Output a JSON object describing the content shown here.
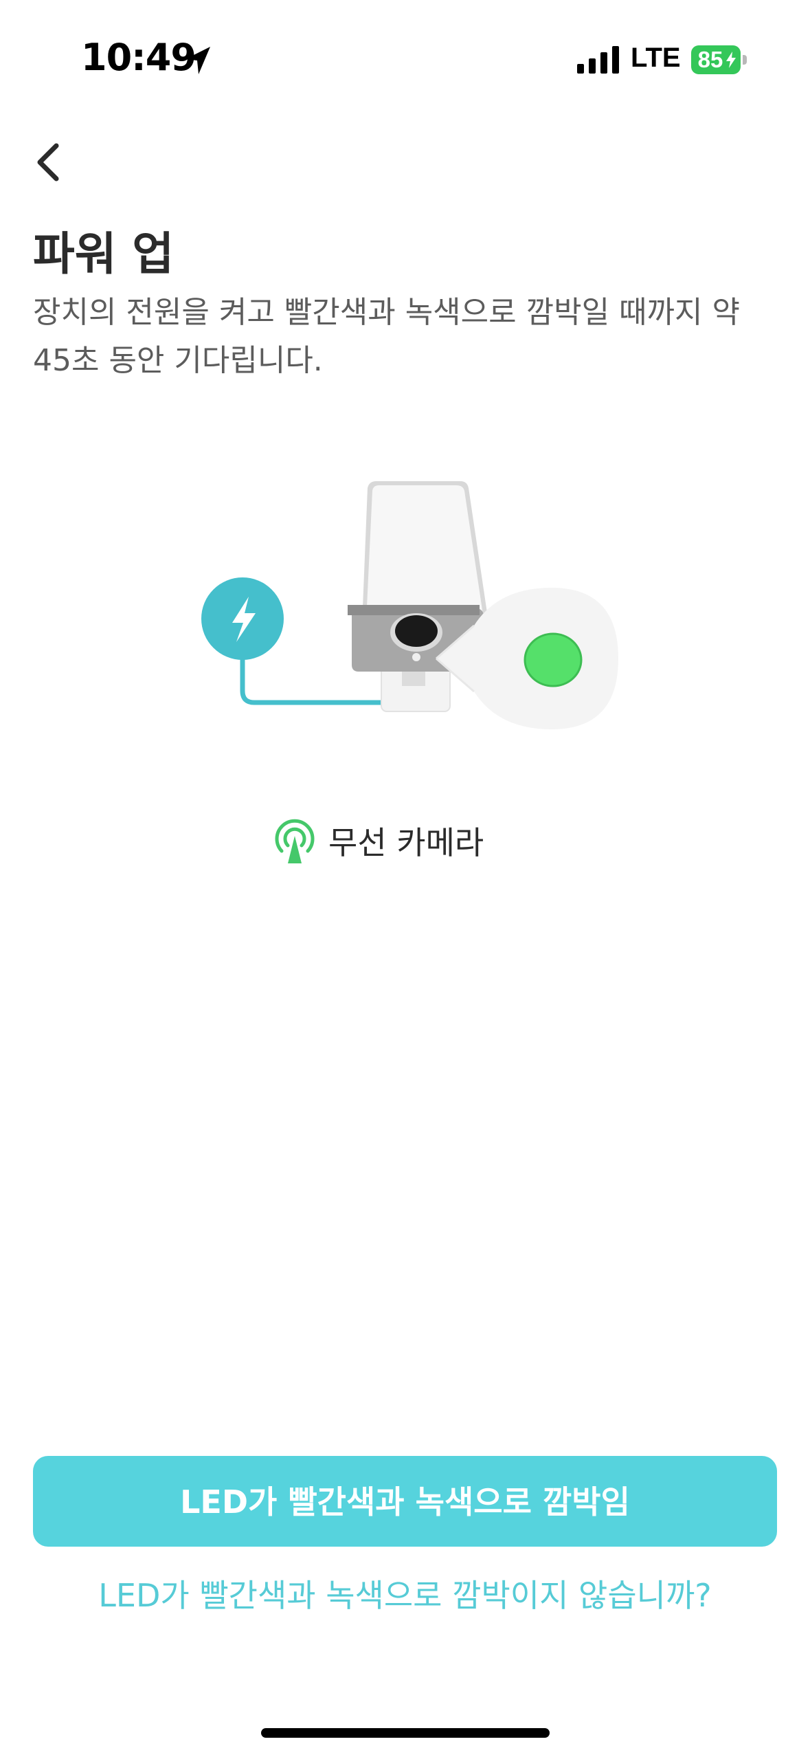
{
  "status_bar": {
    "time": "10:49",
    "network": "LTE",
    "battery": "85",
    "battery_color": "#34c759"
  },
  "header": {
    "back_icon": "chevron-left-icon"
  },
  "page": {
    "title": "파워 업",
    "description": "장치의 전원을 켜고 빨간색과 녹색으로 깜박일 때까지 약 45초 동안 기다립니다."
  },
  "illustration": {
    "power_icon": "lightning-bolt-icon",
    "led_color": "#55e06a",
    "accent_color": "#45bfcc"
  },
  "device": {
    "icon": "wireless-antenna-icon",
    "label": "무선 카메라"
  },
  "actions": {
    "primary_label": "LED가 빨간색과 녹색으로 깜박임",
    "secondary_label": "LED가 빨간색과 녹색으로 깜박이지 않습니까?",
    "primary_color": "#56d3dd"
  }
}
